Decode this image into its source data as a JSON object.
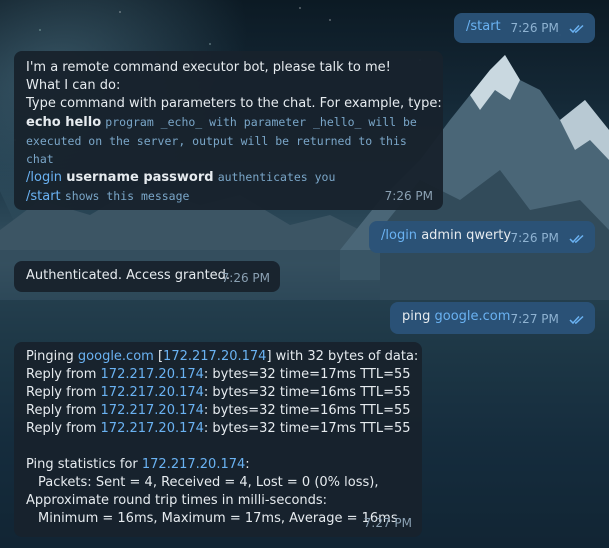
{
  "messages": {
    "m1": {
      "text": "/start",
      "time": "7:26 PM"
    },
    "m2": {
      "l1": "I'm a remote command executor bot, please talk to me!",
      "l2": "What I can do:",
      "l3": "Type command with parameters to the chat. For example, type:",
      "l4_cmd": "echo hello",
      "l4_desc": "program _echo_ with parameter _hello_ will be",
      "l5": "executed on the server, output will be returned to this",
      "l6": "chat",
      "l7_cmd": "/login",
      "l7_args": "username password",
      "l7_desc": "authenticates you",
      "l8_cmd": "/start",
      "l8_desc": "shows this message",
      "time": "7:26 PM"
    },
    "m3": {
      "cmd": "/login",
      "args": "admin qwerty",
      "time": "7:26 PM"
    },
    "m4": {
      "text": "Authenticated. Access granted.",
      "time": "7:26 PM"
    },
    "m5": {
      "prefix": "ping",
      "link": "google.com",
      "time": "7:27 PM"
    },
    "m6": {
      "p1": "Pinging",
      "p1_link": "google.com",
      "p1_open": "[",
      "p1_ip": "172.217.20.174",
      "p1_rest": "] with 32 bytes of data:",
      "replies": [
        {
          "pre": "Reply from",
          "ip": "172.217.20.174",
          "rest": ": bytes=32 time=17ms TTL=55"
        },
        {
          "pre": "Reply from",
          "ip": "172.217.20.174",
          "rest": ": bytes=32 time=16ms TTL=55"
        },
        {
          "pre": "Reply from",
          "ip": "172.217.20.174",
          "rest": ": bytes=32 time=16ms TTL=55"
        },
        {
          "pre": "Reply from",
          "ip": "172.217.20.174",
          "rest": ": bytes=32 time=17ms TTL=55"
        }
      ],
      "stats_pre": "Ping statistics for",
      "stats_ip": "172.217.20.174",
      "stats_colon": ":",
      "packets": "Packets: Sent = 4, Received = 4, Lost = 0 (0% loss),",
      "approx": "Approximate round trip times in milli-seconds:",
      "minmax": "Minimum = 16ms, Maximum = 17ms, Average = 16ms",
      "time": "7:27 PM"
    }
  },
  "icons": {
    "read": "double-check-icon"
  },
  "colors": {
    "incoming": "#18222d",
    "outgoing": "#2b5278",
    "link": "#6ab2f2"
  }
}
